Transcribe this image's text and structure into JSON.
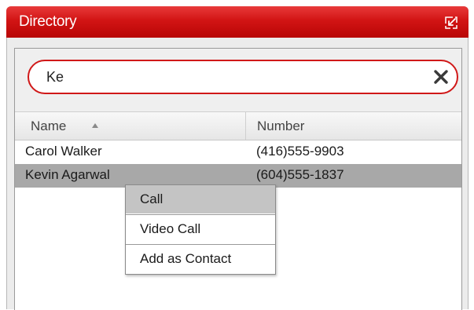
{
  "window": {
    "title": "Directory"
  },
  "search": {
    "value": "Ke",
    "placeholder": ""
  },
  "table": {
    "columns": [
      "Name",
      "Number"
    ],
    "sort": {
      "column": "Name",
      "direction": "ascending"
    },
    "rows": [
      {
        "name": "Carol Walker",
        "number": "(416)555-9903",
        "selected": false
      },
      {
        "name": "Kevin Agarwal",
        "number": "(604)555-1837",
        "selected": true
      }
    ]
  },
  "context_menu": {
    "items": [
      {
        "label": "Call",
        "highlighted": true
      },
      {
        "label": "Video Call",
        "highlighted": false
      },
      {
        "label": "Add as Contact",
        "highlighted": false
      }
    ]
  },
  "colors": {
    "title_bar": "#d21414",
    "search_border": "#d01818",
    "selected_row": "#a8a8a8",
    "menu_highlight": "#c4c4c4"
  },
  "icons": {
    "popout": "popout-icon",
    "clear": "close-icon",
    "sort": "sort-ascending-icon"
  }
}
